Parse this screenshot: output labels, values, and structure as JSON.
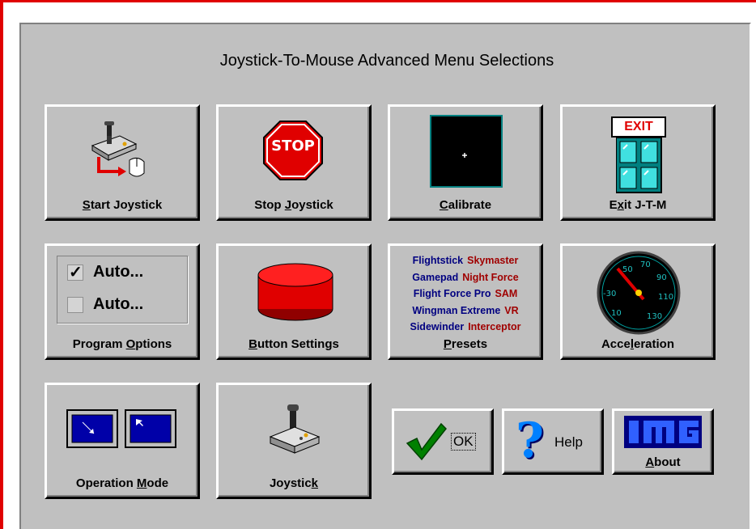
{
  "window": {
    "title": "Joystick-To-Mouse Advanced Menu Selections"
  },
  "buttons": {
    "start_joystick": {
      "pre": "",
      "u": "S",
      "post": "tart Joystick",
      "icon": "joystick-mouse-icon"
    },
    "stop_joystick": {
      "pre": "Stop ",
      "u": "J",
      "post": "oystick",
      "icon": "stop-sign-icon",
      "sign_text": "STOP"
    },
    "calibrate": {
      "pre": "",
      "u": "C",
      "post": "alibrate",
      "icon": "calibrate-screen-icon"
    },
    "exit": {
      "pre": "E",
      "u": "x",
      "post": "it J-T-M",
      "icon": "exit-door-icon",
      "sign_text": "EXIT"
    },
    "program_options": {
      "pre": "Program ",
      "u": "O",
      "post": "ptions",
      "icon": "checkbox-options-icon",
      "option1": "Auto...",
      "option2": "Auto..."
    },
    "button_settings": {
      "pre": "",
      "u": "B",
      "post": "utton Settings",
      "icon": "red-button-icon"
    },
    "presets": {
      "pre": "",
      "u": "P",
      "post": "resets",
      "icon": "preset-list",
      "rows": [
        [
          "Flightstick",
          "Skymaster"
        ],
        [
          "Gamepad",
          "Night Force"
        ],
        [
          "Flight Force Pro",
          "SAM"
        ],
        [
          "Wingman Extreme",
          "VR"
        ],
        [
          "Sidewinder",
          "Interceptor"
        ]
      ]
    },
    "acceleration": {
      "pre": "Acce",
      "u": "l",
      "post": "eration",
      "icon": "speedometer-icon",
      "gauge_labels": [
        "50",
        "70",
        "90",
        "110",
        "130",
        "10",
        "-30"
      ]
    },
    "operation_mode": {
      "pre": "Operation ",
      "u": "M",
      "post": "ode",
      "icon": "monitors-icon"
    },
    "joystick": {
      "pre": "Joystic",
      "u": "k",
      "post": "",
      "icon": "joystick-icon"
    },
    "ok": {
      "label": "OK",
      "icon": "checkmark-icon"
    },
    "help": {
      "label": "Help",
      "icon": "question-mark-icon"
    },
    "about": {
      "pre": "",
      "u": "A",
      "post": "bout",
      "icon": "img-logo-icon"
    }
  },
  "colors": {
    "panel": "#c0c0c0",
    "frame": "#e00000",
    "preset_blue": "#000080",
    "preset_red": "#a00000"
  }
}
